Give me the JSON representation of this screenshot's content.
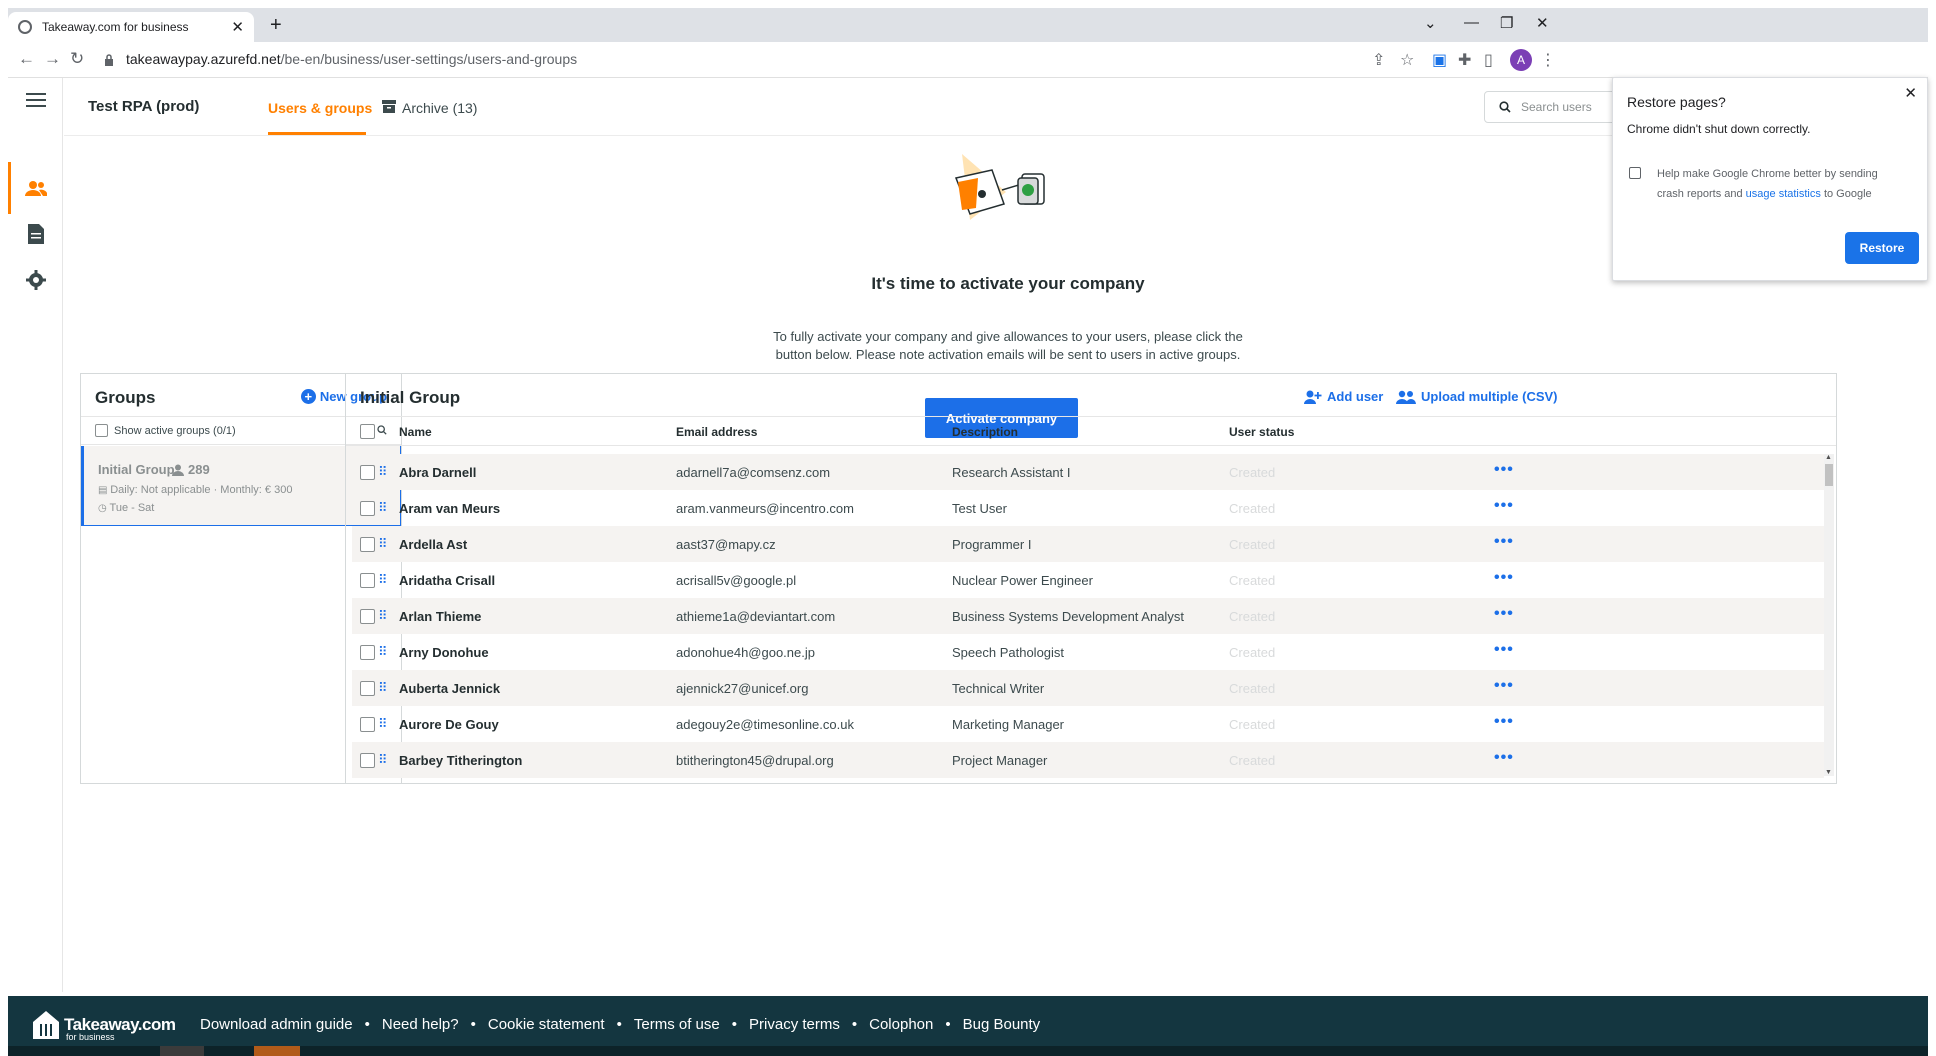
{
  "browser": {
    "tab_title": "Takeaway.com for business",
    "url_host": "takeawaypay.azurefd.net",
    "url_path": "/be-en/business/user-settings/users-and-groups",
    "profile_initial": "A"
  },
  "header": {
    "company": "Test RPA (prod)",
    "tab_users": "Users & groups",
    "tab_archive": "Archive (13)",
    "search_placeholder": "Search users"
  },
  "hero": {
    "title": "It's time to activate your company",
    "text": "To fully activate your company and give allowances to your users, please click the button below. Please note activation emails will be sent to users in active groups.",
    "button": "Activate company"
  },
  "groups": {
    "title": "Groups",
    "new_group": "New group",
    "filter_label": "Show active groups (0/1)",
    "items": [
      {
        "name": "Initial Group",
        "count": "289",
        "allowance": "Daily: Not applicable · Monthly: € 300",
        "days": "Tue - Sat"
      }
    ]
  },
  "users": {
    "title": "Initial Group",
    "add_user": "Add user",
    "upload": "Upload multiple (CSV)",
    "columns": [
      "Name",
      "Email address",
      "Description",
      "User status"
    ],
    "rows": [
      {
        "name": "Abra Darnell",
        "email": "adarnell7a@comsenz.com",
        "description": "Research Assistant I",
        "status": "Created"
      },
      {
        "name": "Aram van Meurs",
        "email": "aram.vanmeurs@incentro.com",
        "description": "Test User",
        "status": "Created"
      },
      {
        "name": "Ardella Ast",
        "email": "aast37@mapy.cz",
        "description": "Programmer I",
        "status": "Created"
      },
      {
        "name": "Aridatha Crisall",
        "email": "acrisall5v@google.pl",
        "description": "Nuclear Power Engineer",
        "status": "Created"
      },
      {
        "name": "Arlan Thieme",
        "email": "athieme1a@deviantart.com",
        "description": "Business Systems Development Analyst",
        "status": "Created"
      },
      {
        "name": "Arny Donohue",
        "email": "adonohue4h@goo.ne.jp",
        "description": "Speech Pathologist",
        "status": "Created"
      },
      {
        "name": "Auberta Jennick",
        "email": "ajennick27@unicef.org",
        "description": "Technical Writer",
        "status": "Created"
      },
      {
        "name": "Aurore De Gouy",
        "email": "adegouy2e@timesonline.co.uk",
        "description": "Marketing Manager",
        "status": "Created"
      },
      {
        "name": "Barbey Titherington",
        "email": "btitherington45@drupal.org",
        "description": "Project Manager",
        "status": "Created"
      }
    ]
  },
  "footer": {
    "brand": "Takeaway.com",
    "brand_sub": "for business",
    "links": [
      "Download admin guide",
      "Need help?",
      "Cookie statement",
      "Terms of use",
      "Privacy terms",
      "Colophon",
      "Bug Bounty"
    ]
  },
  "restore_popup": {
    "title": "Restore pages?",
    "message": "Chrome didn't shut down correctly.",
    "help_text_1": "Help make Google Chrome better by sending crash reports and",
    "help_link": "usage statistics",
    "help_text_2": "to Google",
    "button": "Restore"
  },
  "colors": {
    "accent": "#ff8000",
    "primary": "#1c6fe8",
    "footer": "#143640"
  }
}
